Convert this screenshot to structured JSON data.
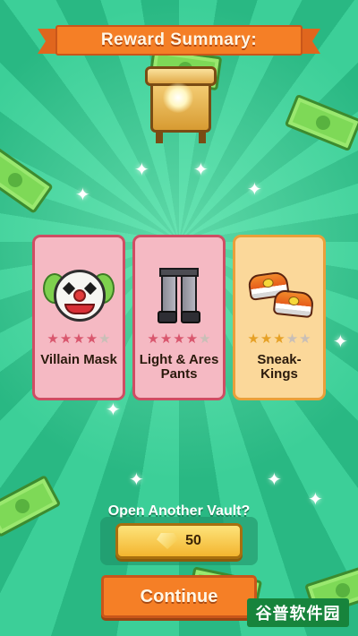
{
  "header": {
    "title": "Reward Summary:"
  },
  "colors": {
    "background": "#2fc38f",
    "banner": "#f57f26",
    "epic_card": "#f5b9c3",
    "epic_border": "#cf4d63",
    "legendary_card": "#fbd89a",
    "legendary_border": "#e9a03a",
    "star_pink": "#d9566d",
    "star_gold": "#e6a126",
    "star_empty": "#c9bfb7"
  },
  "vault": {
    "icon": "treasure-vault-icon"
  },
  "rewards": [
    {
      "name": "Villain Mask",
      "icon": "clown-mask-icon",
      "stars_filled": 4,
      "stars_total": 5,
      "star_color": "#d9566d"
    },
    {
      "name": "Light & Ares Pants",
      "icon": "armored-pants-icon",
      "stars_filled": 4,
      "stars_total": 5,
      "star_color": "#d9566d"
    },
    {
      "name": "Sneak-Kings",
      "icon": "sneakers-icon",
      "stars_filled": 3,
      "stars_total": 5,
      "star_color": "#e6a126"
    }
  ],
  "open_another": {
    "label": "Open Another Vault?",
    "cost": "50",
    "cost_icon": "gem-icon"
  },
  "continue_button": {
    "label": "Continue"
  },
  "watermark": {
    "text": "谷普软件园"
  }
}
